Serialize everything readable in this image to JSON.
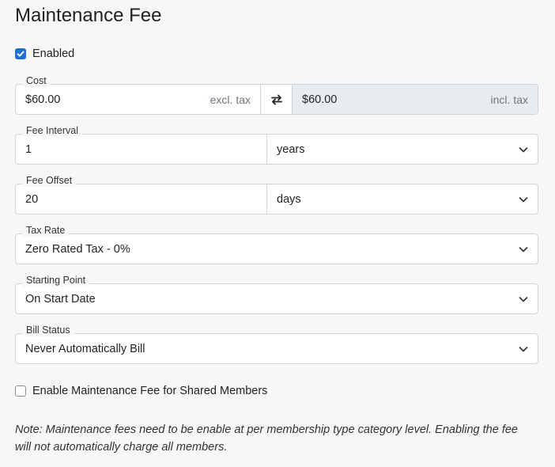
{
  "page": {
    "title": "Maintenance Fee"
  },
  "enabled": {
    "label": "Enabled",
    "checked": true
  },
  "cost": {
    "label": "Cost",
    "excl_value": "$60.00",
    "excl_suffix": "excl. tax",
    "swap_icon": "swap-arrows-icon",
    "incl_value": "$60.00",
    "incl_suffix": "incl. tax"
  },
  "fee_interval": {
    "label": "Fee Interval",
    "value": "1",
    "unit": "years"
  },
  "fee_offset": {
    "label": "Fee Offset",
    "value": "20",
    "unit": "days"
  },
  "tax_rate": {
    "label": "Tax Rate",
    "value": "Zero Rated Tax - 0%"
  },
  "starting_point": {
    "label": "Starting Point",
    "value": "On Start Date"
  },
  "bill_status": {
    "label": "Bill Status",
    "value": "Never Automatically Bill"
  },
  "shared_members": {
    "label": "Enable Maintenance Fee for Shared Members",
    "checked": false
  },
  "note": "Note: Maintenance fees need to be enable at per membership type category level. Enabling the fee will not automatically charge all members.",
  "colors": {
    "accent": "#1f6fd0",
    "border": "#ced4da",
    "disabled_bg": "#e9ecef"
  }
}
